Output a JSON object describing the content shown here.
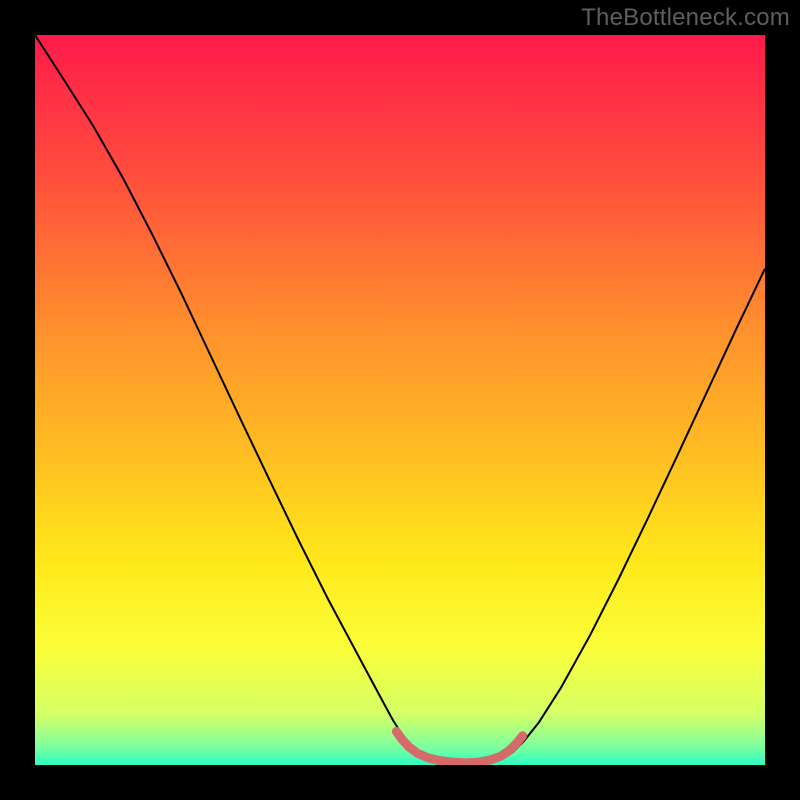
{
  "watermark": "TheBottleneck.com",
  "chart_data": {
    "type": "line",
    "title": "",
    "xlabel": "",
    "ylabel": "",
    "xlim": [
      0,
      1
    ],
    "ylim": [
      0,
      1
    ],
    "gradient": {
      "stops": [
        {
          "offset": 0.0,
          "color": "#ff1a4b"
        },
        {
          "offset": 0.18,
          "color": "#ff4a3e"
        },
        {
          "offset": 0.4,
          "color": "#ff8f2d"
        },
        {
          "offset": 0.58,
          "color": "#ffbf22"
        },
        {
          "offset": 0.72,
          "color": "#ffe81a"
        },
        {
          "offset": 0.84,
          "color": "#fbff3a"
        },
        {
          "offset": 0.93,
          "color": "#d4ff66"
        },
        {
          "offset": 0.975,
          "color": "#7dff9e"
        },
        {
          "offset": 1.0,
          "color": "#2bffc5"
        }
      ]
    },
    "series": [
      {
        "name": "bottleneck-curve",
        "stroke": "#000000",
        "stroke_width": 2,
        "points": [
          [
            0.0,
            1.0
          ],
          [
            0.04,
            0.938
          ],
          [
            0.08,
            0.875
          ],
          [
            0.12,
            0.805
          ],
          [
            0.16,
            0.728
          ],
          [
            0.2,
            0.647
          ],
          [
            0.24,
            0.562
          ],
          [
            0.28,
            0.477
          ],
          [
            0.32,
            0.393
          ],
          [
            0.36,
            0.31
          ],
          [
            0.4,
            0.23
          ],
          [
            0.44,
            0.155
          ],
          [
            0.47,
            0.099
          ],
          [
            0.49,
            0.062
          ],
          [
            0.505,
            0.038
          ],
          [
            0.52,
            0.021
          ],
          [
            0.535,
            0.01
          ],
          [
            0.55,
            0.004
          ],
          [
            0.57,
            0.0
          ],
          [
            0.6,
            0.0
          ],
          [
            0.62,
            0.002
          ],
          [
            0.64,
            0.008
          ],
          [
            0.655,
            0.018
          ],
          [
            0.67,
            0.033
          ],
          [
            0.69,
            0.058
          ],
          [
            0.72,
            0.105
          ],
          [
            0.76,
            0.177
          ],
          [
            0.8,
            0.256
          ],
          [
            0.84,
            0.339
          ],
          [
            0.88,
            0.424
          ],
          [
            0.92,
            0.51
          ],
          [
            0.96,
            0.596
          ],
          [
            1.0,
            0.68
          ]
        ]
      },
      {
        "name": "baseline-marker",
        "stroke": "#d46a6a",
        "stroke_width": 9,
        "linecap": "round",
        "points": [
          [
            0.495,
            0.046
          ],
          [
            0.502,
            0.036
          ],
          [
            0.512,
            0.025
          ],
          [
            0.524,
            0.016
          ],
          [
            0.538,
            0.01
          ],
          [
            0.554,
            0.006
          ],
          [
            0.572,
            0.004
          ],
          [
            0.59,
            0.003
          ],
          [
            0.608,
            0.004
          ],
          [
            0.624,
            0.007
          ],
          [
            0.638,
            0.012
          ],
          [
            0.65,
            0.02
          ],
          [
            0.66,
            0.03
          ],
          [
            0.668,
            0.04
          ]
        ]
      }
    ]
  }
}
